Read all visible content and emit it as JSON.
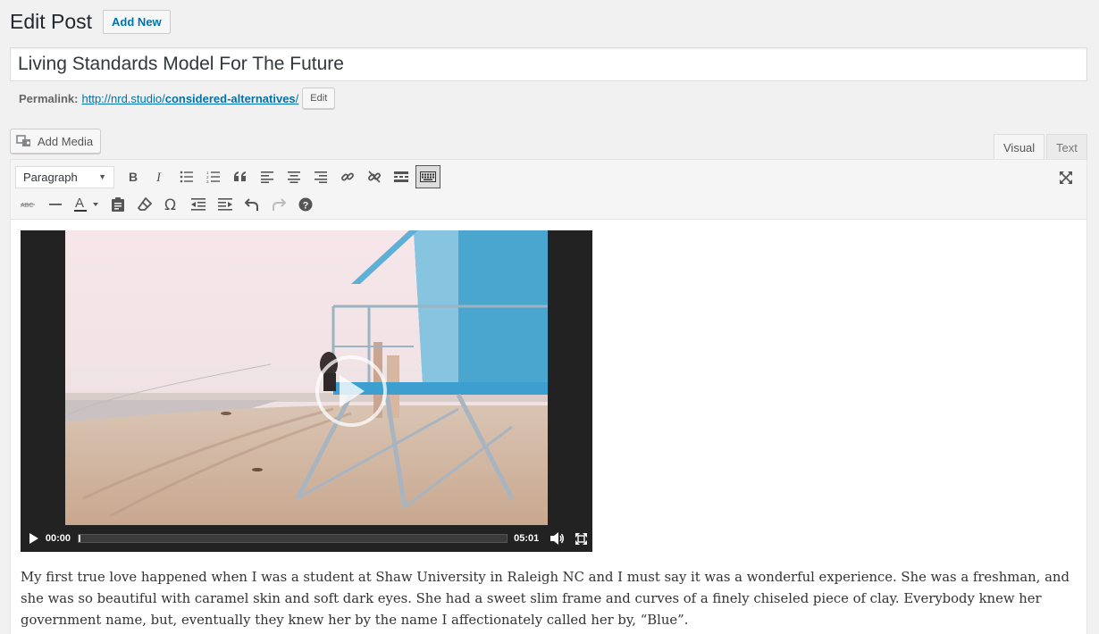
{
  "header": {
    "title": "Edit Post",
    "add_new": "Add New"
  },
  "post": {
    "title": "Living Standards Model For The Future",
    "permalink_label": "Permalink:",
    "permalink_base": "http://nrd.studio/",
    "permalink_slug": "considered-alternatives",
    "permalink_tail": "/",
    "permalink_edit": "Edit"
  },
  "editor": {
    "add_media": "Add Media",
    "tabs": {
      "visual": "Visual",
      "text": "Text"
    },
    "format_select": "Paragraph",
    "video": {
      "current_time": "00:00",
      "duration": "05:01",
      "progress": 0.0
    },
    "body_text": "My first true love happened when I was a student at Shaw University in Raleigh NC and I must say it was a wonderful experience. She was a freshman, and she was so beautiful with caramel skin and soft dark eyes. She had a sweet slim frame and curves of a finely chiseled piece of clay. Everybody knew her government name, but, eventually they knew her by the name I affectionately called her by, “Blue”."
  },
  "colors": {
    "link": "#0073aa",
    "accent_blue": "#3c9fd0",
    "background": "#f1f1f1"
  }
}
